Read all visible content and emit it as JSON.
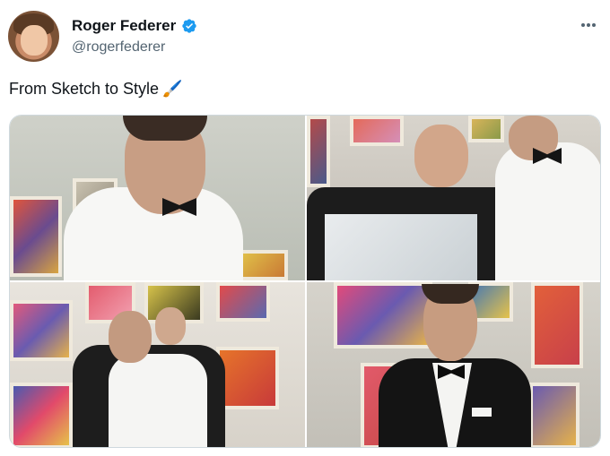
{
  "author": {
    "display_name": "Roger Federer",
    "handle": "@rogerfederer",
    "verified": true,
    "verified_icon": "verified-badge-icon",
    "avatar_icon": "avatar-image"
  },
  "tweet": {
    "text": "From Sketch to Style",
    "emoji": "🖌️"
  },
  "menu": {
    "more_icon": "more-options-icon"
  },
  "media": {
    "photo_count": 4,
    "photos": [
      {
        "alt": "man in white shirt and bow tie"
      },
      {
        "alt": "two men holding a decorated jacket"
      },
      {
        "alt": "man being helped into a jacket"
      },
      {
        "alt": "man in tuxedo adjusting jacket"
      }
    ]
  },
  "colors": {
    "text_primary": "#0f1419",
    "text_secondary": "#536471",
    "verified_blue": "#1d9bf0",
    "border": "#cfd9de"
  }
}
